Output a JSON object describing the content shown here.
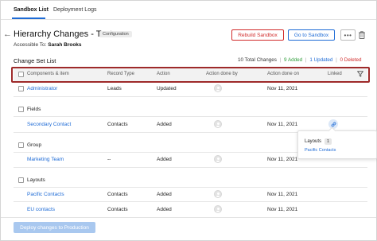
{
  "tabs": [
    {
      "label": "Sandbox List",
      "active": true
    },
    {
      "label": "Deployment Logs",
      "active": false
    }
  ],
  "header": {
    "title": "Hierarchy Changes - Test",
    "badge": "Configuration",
    "accessible_prefix": "Accessible To:",
    "accessible_user": "Sarah Brooks",
    "rebuild_label": "Rebuild Sandbox",
    "goto_label": "Go to Sandbox",
    "more_label": "•••"
  },
  "change_set": {
    "title": "Change Set List",
    "total": "10 Total Changes",
    "added": "9 Added",
    "updated": "1 Updated",
    "deleted": "0 Deleted",
    "separator": "|"
  },
  "columns": [
    "Components & item",
    "Record Type",
    "Action",
    "Action done by",
    "Action done on",
    "Linked"
  ],
  "groups": [
    {
      "label": "",
      "rows": [
        {
          "item": "Administrator",
          "record_type": "Leads",
          "action": "Updated",
          "date": "Nov 11, 2021"
        }
      ]
    },
    {
      "label": "Fields",
      "rows": [
        {
          "item": "Secondary Contact",
          "record_type": "Contacts",
          "action": "Added",
          "date": "Nov 11, 2021"
        }
      ]
    },
    {
      "label": "Group",
      "rows": [
        {
          "item": "Marketing Team",
          "record_type": "--",
          "action": "Added",
          "date": "Nov 11, 2021"
        }
      ]
    },
    {
      "label": "Layouts",
      "rows": [
        {
          "item": "Pacific Contacts",
          "record_type": "Contacts",
          "action": "Added",
          "date": "Nov 11, 2021"
        },
        {
          "item": "EU contacts",
          "record_type": "Contacts",
          "action": "Added",
          "date": "Nov 11, 2021"
        }
      ]
    }
  ],
  "popover": {
    "title": "Layouts",
    "count": "1",
    "link": "Pacific Contacts"
  },
  "footer": {
    "deploy_label": "Deploy changes to Production"
  },
  "colors": {
    "accent": "#1e6bd6",
    "danger": "#d12b2b",
    "success": "#2e9d3a",
    "highlight_border": "#9e2a2a"
  }
}
